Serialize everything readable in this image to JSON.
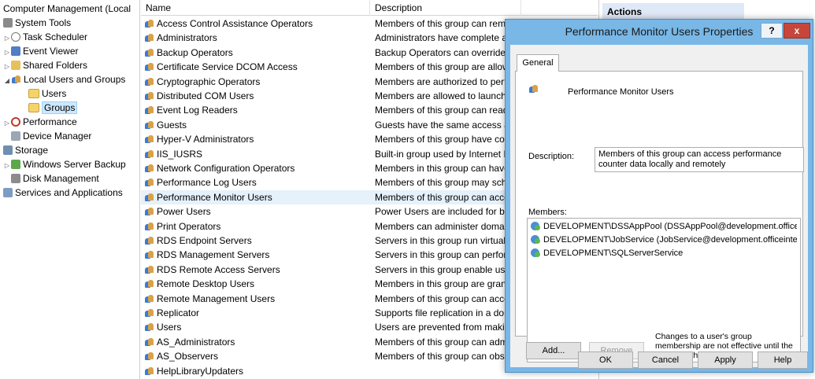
{
  "tree": {
    "items": [
      {
        "label": "Computer Management (Local",
        "expander": "",
        "icon": "computer-management-icon"
      },
      {
        "label": "System Tools",
        "expander": "",
        "icon": "system-tools-icon"
      },
      {
        "label": "Task Scheduler",
        "expander": "▷",
        "icon": "clock-icon"
      },
      {
        "label": "Event Viewer",
        "expander": "▷",
        "icon": "event-viewer-icon"
      },
      {
        "label": "Shared Folders",
        "expander": "▷",
        "icon": "shared-folders-icon"
      },
      {
        "label": "Local Users and Groups",
        "expander": "◢",
        "icon": "users-icon"
      },
      {
        "label": "Users",
        "expander": "",
        "icon": "folder-icon"
      },
      {
        "label": "Groups",
        "expander": "",
        "icon": "folder-icon"
      },
      {
        "label": "Performance",
        "expander": "▷",
        "icon": "performance-icon"
      },
      {
        "label": "Device Manager",
        "expander": "",
        "icon": "device-manager-icon"
      },
      {
        "label": "Storage",
        "expander": "",
        "icon": "storage-icon"
      },
      {
        "label": "Windows Server Backup",
        "expander": "▷",
        "icon": "backup-icon"
      },
      {
        "label": "Disk Management",
        "expander": "",
        "icon": "disk-icon"
      },
      {
        "label": "Services and Applications",
        "expander": "",
        "icon": "services-icon"
      }
    ]
  },
  "list": {
    "columns": {
      "name": "Name",
      "description": "Description"
    },
    "rows": [
      {
        "name": "Access Control Assistance Operators",
        "desc": "Members of this group can rem"
      },
      {
        "name": "Administrators",
        "desc": "Administrators have complete a"
      },
      {
        "name": "Backup Operators",
        "desc": "Backup Operators can override s"
      },
      {
        "name": "Certificate Service DCOM Access",
        "desc": "Members of this group are allow"
      },
      {
        "name": "Cryptographic Operators",
        "desc": "Members are authorized to perfo"
      },
      {
        "name": "Distributed COM Users",
        "desc": "Members are allowed to launch,"
      },
      {
        "name": "Event Log Readers",
        "desc": "Members of this group can read"
      },
      {
        "name": "Guests",
        "desc": "Guests have the same access as"
      },
      {
        "name": "Hyper-V Administrators",
        "desc": "Members of this group have cor"
      },
      {
        "name": "IIS_IUSRS",
        "desc": "Built-in group used by Internet I"
      },
      {
        "name": "Network Configuration Operators",
        "desc": "Members in this group can have"
      },
      {
        "name": "Performance Log Users",
        "desc": "Members of this group may sch"
      },
      {
        "name": "Performance Monitor Users",
        "desc": "Members of this group can acce"
      },
      {
        "name": "Power Users",
        "desc": "Power Users are included for ba"
      },
      {
        "name": "Print Operators",
        "desc": "Members can administer domai"
      },
      {
        "name": "RDS Endpoint Servers",
        "desc": "Servers in this group run virtual"
      },
      {
        "name": "RDS Management Servers",
        "desc": "Servers in this group can perfor"
      },
      {
        "name": "RDS Remote Access Servers",
        "desc": "Servers in this group enable use"
      },
      {
        "name": "Remote Desktop Users",
        "desc": "Members in this group are grant"
      },
      {
        "name": "Remote Management Users",
        "desc": "Members of this group can acce"
      },
      {
        "name": "Replicator",
        "desc": "Supports file replication in a dor"
      },
      {
        "name": "Users",
        "desc": "Users are prevented from makin"
      },
      {
        "name": "AS_Administrators",
        "desc": "Members of this group can adm"
      },
      {
        "name": "AS_Observers",
        "desc": "Members of this group can obse"
      },
      {
        "name": "HelpLibraryUpdaters",
        "desc": ""
      }
    ]
  },
  "actions": {
    "header": "Actions"
  },
  "dialog": {
    "title": "Performance Monitor Users Properties",
    "help_label": "?",
    "close_label": "x",
    "tab_general": "General",
    "group_name": "Performance Monitor Users",
    "description_label": "Description:",
    "description_value": "Members of this group can access performance counter data locally and remotely",
    "members_label": "Members:",
    "members": [
      "DEVELOPMENT\\DSSAppPool (DSSAppPool@development.officei...",
      "DEVELOPMENT\\JobService (JobService@development.officeinte...",
      "DEVELOPMENT\\SQLServerService"
    ],
    "add_label": "Add...",
    "remove_label": "Remove",
    "note": "Changes to a user's group membership are not effective until the next time the user logs on.",
    "ok_label": "OK",
    "cancel_label": "Cancel",
    "apply_label": "Apply",
    "helpbtn_label": "Help"
  }
}
